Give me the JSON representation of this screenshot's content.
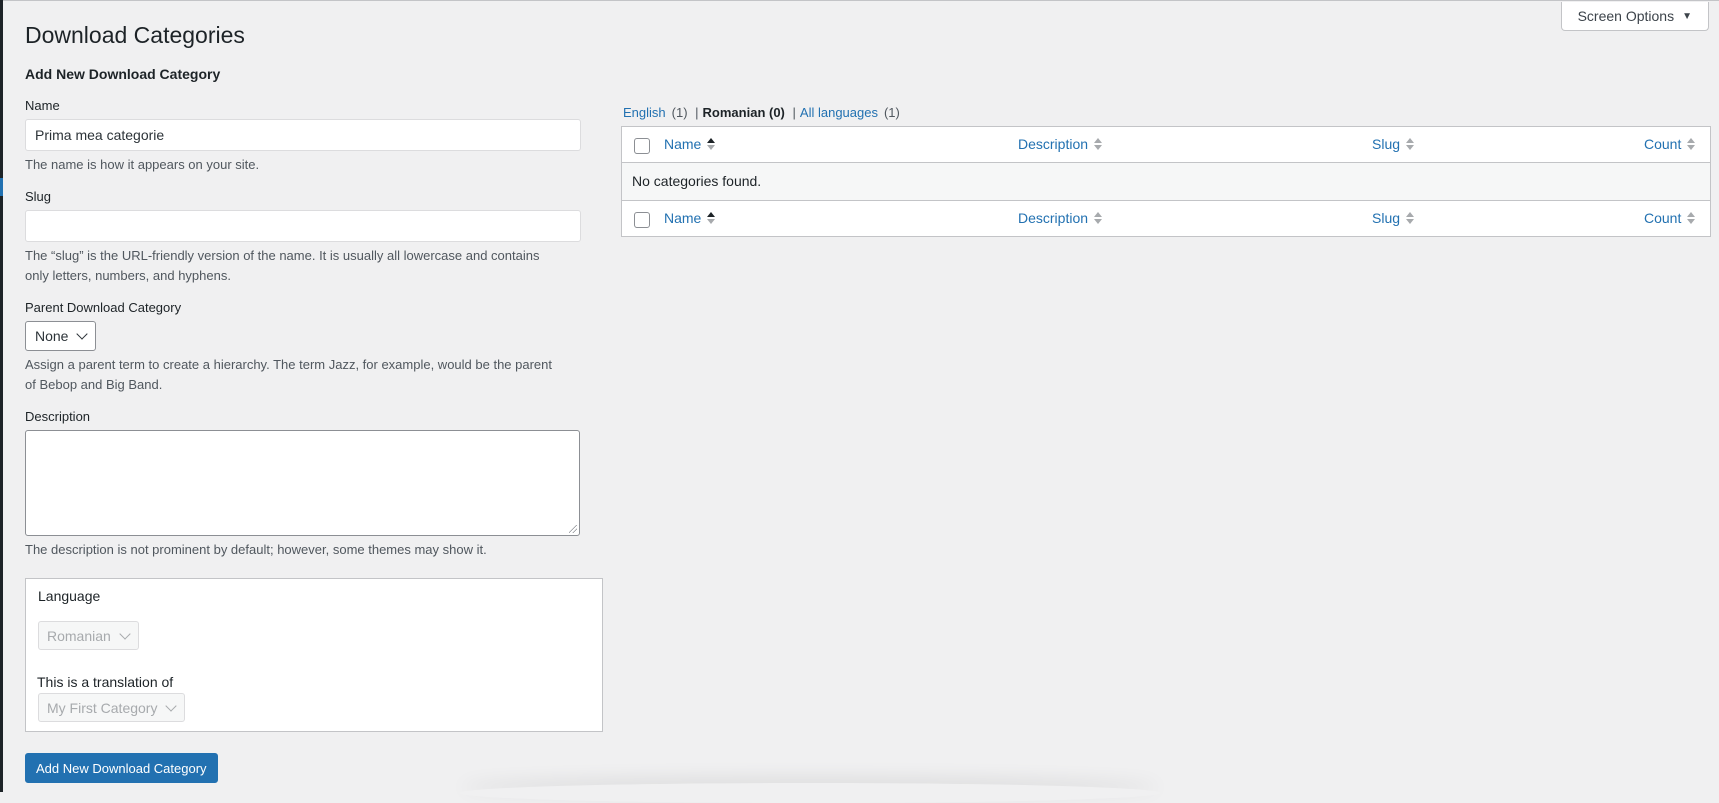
{
  "screen_options": {
    "label": "Screen Options"
  },
  "page": {
    "title": "Download Categories"
  },
  "form": {
    "heading": "Add New Download Category",
    "name": {
      "label": "Name",
      "value": "Prima mea categorie",
      "help": "The name is how it appears on your site."
    },
    "slug": {
      "label": "Slug",
      "value": "",
      "help_line1": "The “slug” is the URL-friendly version of the name. It is usually all lowercase and contains",
      "help_line2": "only letters, numbers, and hyphens."
    },
    "parent": {
      "label": "Parent Download Category",
      "selected": "None",
      "help_line1": "Assign a parent term to create a hierarchy. The term Jazz, for example, would be the parent",
      "help_line2": "of Bebop and Big Band."
    },
    "description": {
      "label": "Description",
      "value": "",
      "help": "The description is not prominent by default; however, some themes may show it."
    },
    "language_box": {
      "label": "Language",
      "selected_language": "Romanian",
      "translation_label": "This is a translation of",
      "translation_selected": "My First Category"
    },
    "submit_label": "Add New Download Category"
  },
  "language_filter": {
    "items": [
      {
        "label": "English",
        "count": "(1)",
        "current": false
      },
      {
        "label": "Romanian (0)",
        "count": "",
        "current": true
      },
      {
        "label": "All languages",
        "count": "(1)",
        "current": false
      }
    ],
    "separator": "|"
  },
  "table": {
    "columns": [
      "Name",
      "Description",
      "Slug",
      "Count"
    ],
    "empty_message": "No categories found."
  },
  "colors": {
    "accent": "#2271b1",
    "background": "#f0f0f1",
    "text": "#1d2327",
    "muted": "#50575e"
  }
}
